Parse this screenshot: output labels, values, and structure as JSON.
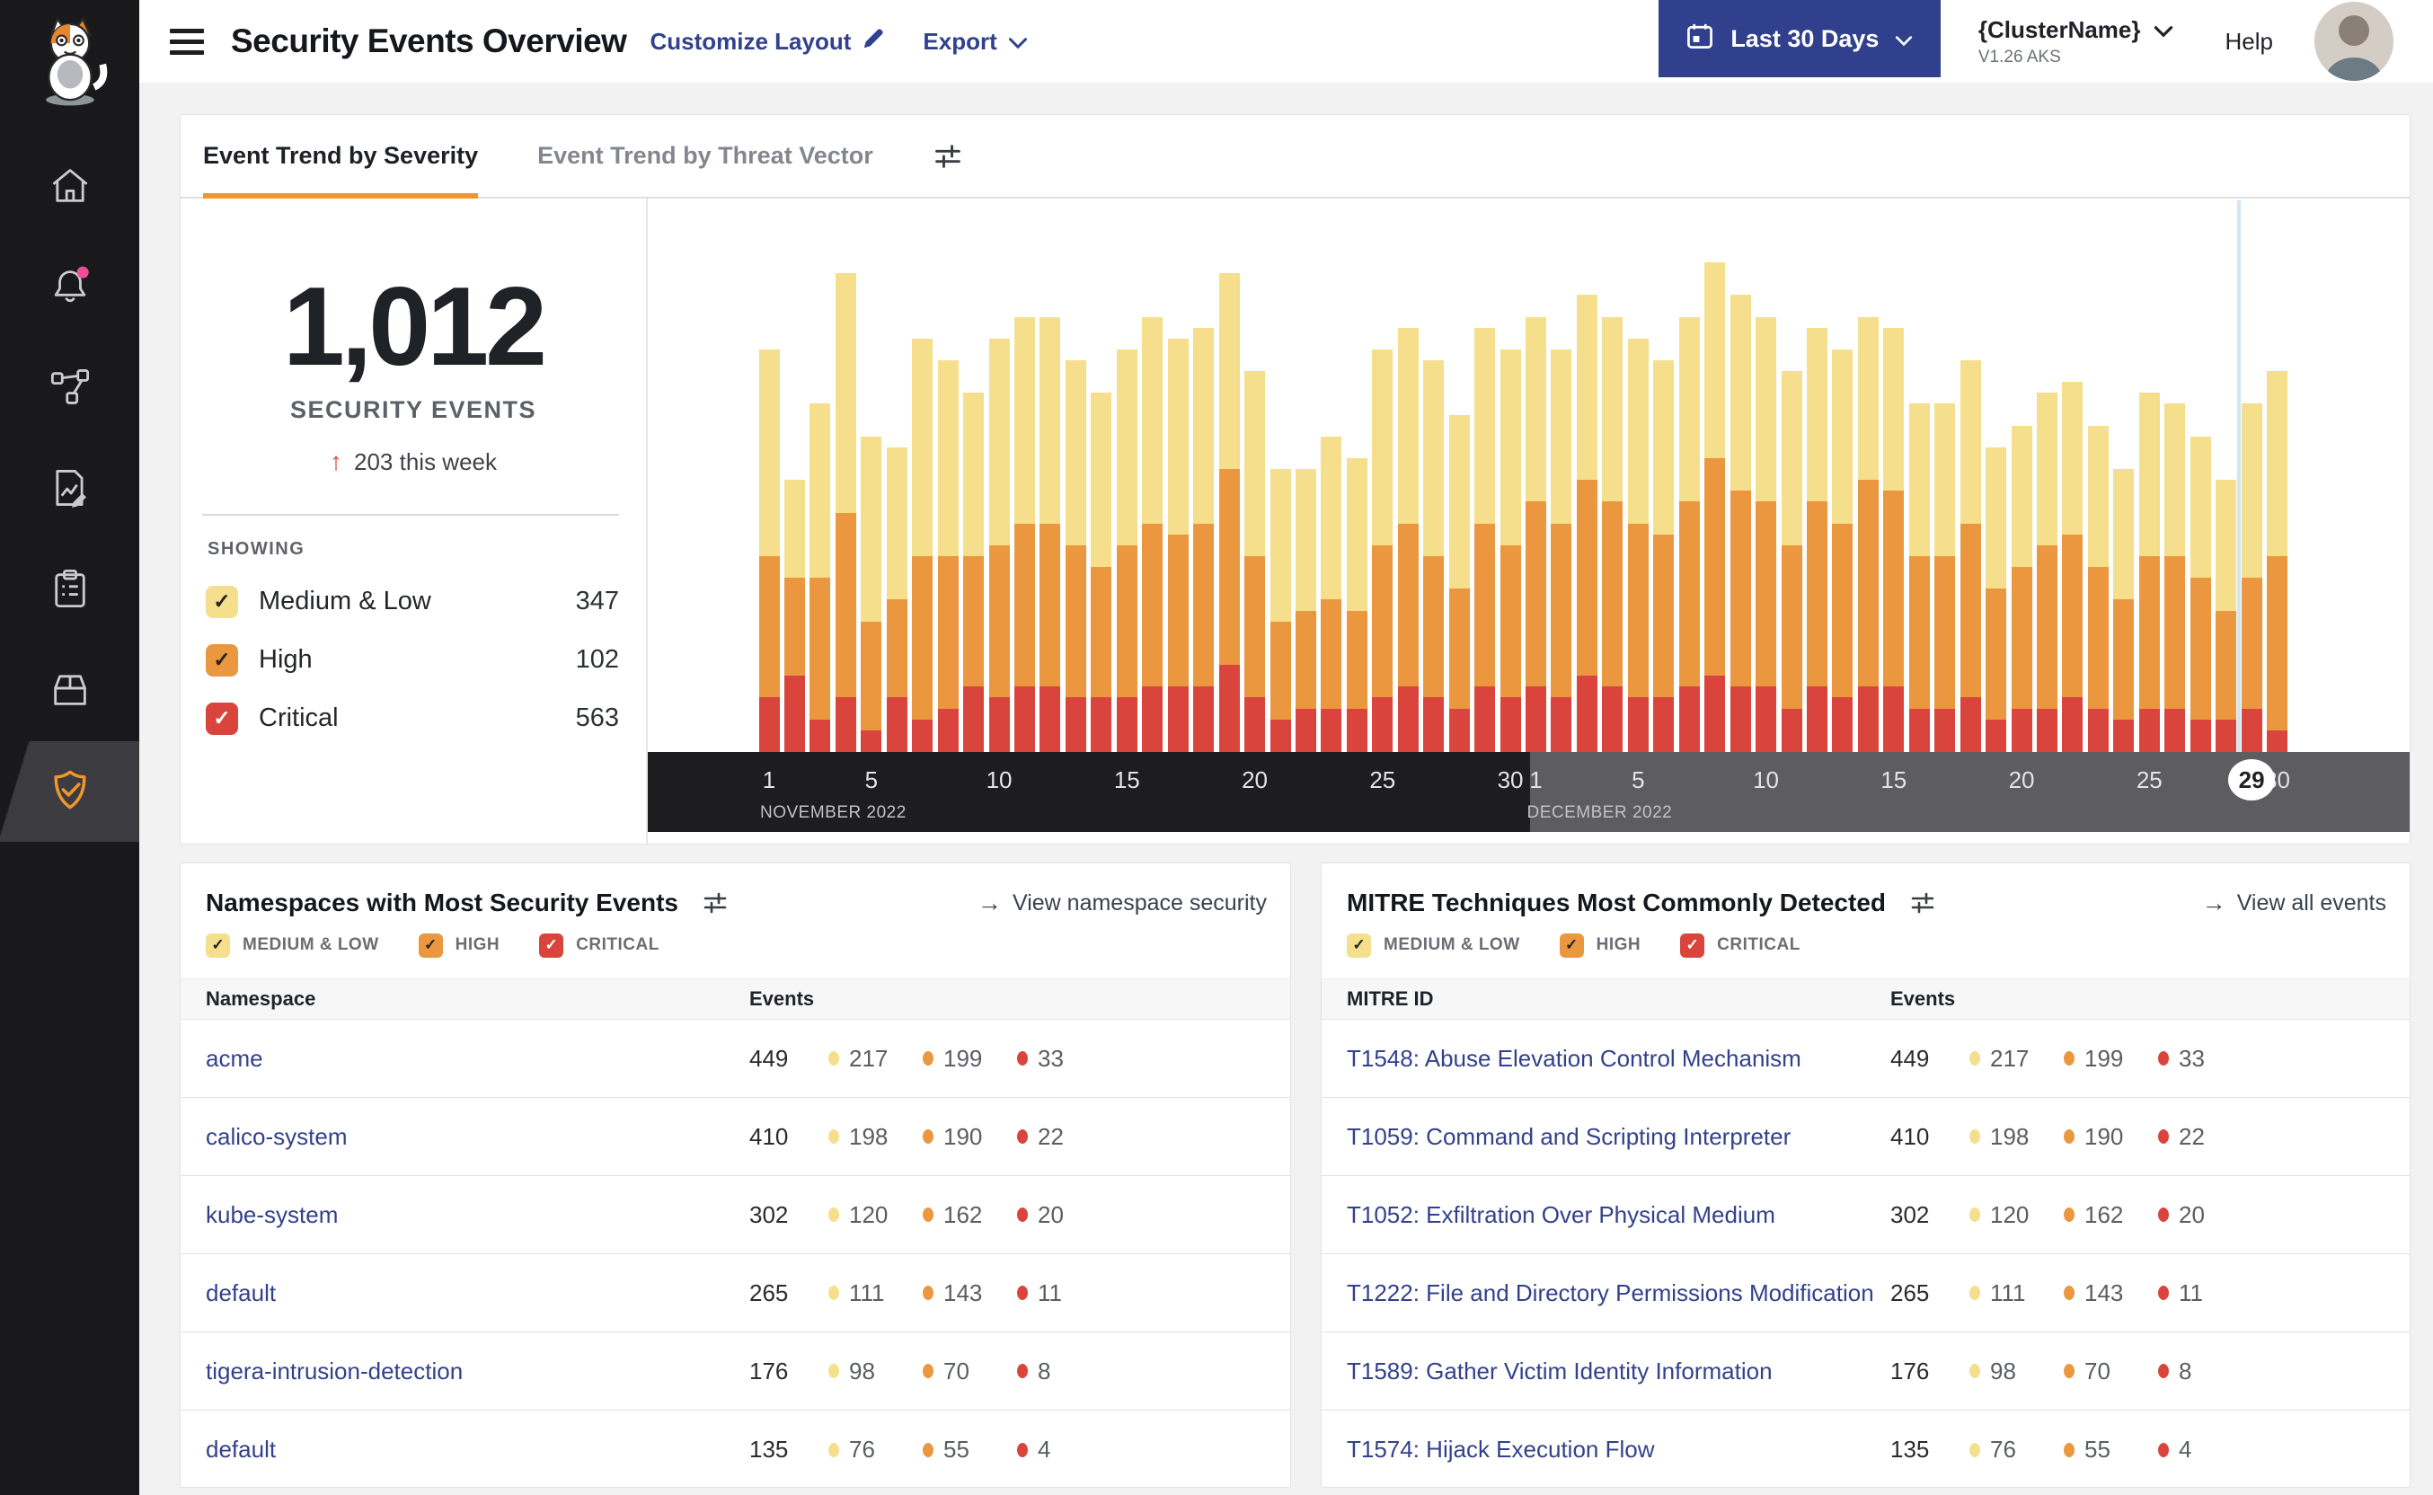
{
  "colors": {
    "medium": "#f5df8c",
    "high": "#eb9740",
    "critical": "#d9453c",
    "accent_orange": "#f0962e",
    "navy": "#30408d",
    "link_blue": "#33418c",
    "notification_pink": "#ef4d98"
  },
  "header": {
    "title": "Security Events Overview",
    "customize_layout": "Customize Layout",
    "export": "Export",
    "date_range": "Last 30 Days",
    "cluster_name": "{ClusterName}",
    "cluster_version": "V1.26 AKS",
    "help": "Help"
  },
  "sidebar": {
    "items": [
      "home",
      "notifications",
      "topology",
      "report",
      "clipboard",
      "package",
      "security"
    ],
    "active_item": "security"
  },
  "trend_card": {
    "tabs": [
      {
        "label": "Event Trend by Severity",
        "active": true
      },
      {
        "label": "Event Trend by Threat Vector",
        "active": false
      }
    ],
    "stats": {
      "total": "1,012",
      "label": "SECURITY EVENTS",
      "delta": "203 this week"
    },
    "showing": {
      "label": "SHOWING",
      "items": [
        {
          "label": "Medium & Low",
          "count": "347",
          "severity": "medium"
        },
        {
          "label": "High",
          "count": "102",
          "severity": "high"
        },
        {
          "label": "Critical",
          "count": "563",
          "severity": "critical"
        }
      ]
    },
    "chart_data": {
      "type": "bar",
      "stacked": true,
      "stack_order": [
        "Critical",
        "High",
        "Medium & Low"
      ],
      "months": [
        {
          "label": "NOVEMBER 2022",
          "days": 30
        },
        {
          "label": "DECEMBER 2022",
          "days": 30
        }
      ],
      "ticks": [
        1,
        5,
        10,
        15,
        20,
        25,
        30
      ],
      "current_day": {
        "month_index": 1,
        "day": 29
      },
      "ylim": [
        0,
        45
      ],
      "series": [
        {
          "name": "Medium & Low",
          "color": "#f5df8c",
          "values": [
            19,
            9,
            16,
            22,
            17,
            14,
            20,
            18,
            15,
            19,
            19,
            19,
            17,
            16,
            18,
            19,
            18,
            18,
            18,
            17,
            14,
            13,
            15,
            14,
            18,
            18,
            18,
            16,
            18,
            18,
            17,
            16,
            17,
            17,
            17,
            16,
            17,
            18,
            18,
            17,
            16,
            16,
            16,
            15,
            15,
            14,
            14,
            15,
            13,
            13,
            14,
            14,
            13,
            12,
            15,
            14,
            13,
            12,
            16,
            17
          ]
        },
        {
          "name": "High",
          "color": "#eb9740",
          "values": [
            13,
            9,
            13,
            17,
            10,
            9,
            15,
            14,
            12,
            14,
            15,
            15,
            14,
            12,
            14,
            15,
            14,
            15,
            18,
            13,
            9,
            9,
            10,
            9,
            14,
            15,
            13,
            11,
            15,
            14,
            17,
            16,
            18,
            17,
            16,
            15,
            17,
            20,
            18,
            17,
            15,
            17,
            16,
            19,
            18,
            14,
            14,
            16,
            12,
            13,
            15,
            15,
            13,
            11,
            14,
            14,
            13,
            10,
            12,
            16
          ]
        },
        {
          "name": "Critical",
          "color": "#d9453c",
          "values": [
            5,
            7,
            3,
            5,
            2,
            5,
            3,
            4,
            6,
            5,
            6,
            6,
            5,
            5,
            5,
            6,
            6,
            6,
            8,
            5,
            3,
            4,
            4,
            4,
            5,
            6,
            5,
            4,
            6,
            5,
            6,
            5,
            7,
            6,
            5,
            5,
            6,
            7,
            6,
            6,
            4,
            6,
            5,
            6,
            6,
            4,
            4,
            5,
            3,
            4,
            4,
            5,
            4,
            3,
            4,
            4,
            3,
            3,
            4,
            2
          ]
        }
      ]
    }
  },
  "namespaces_card": {
    "title": "Namespaces with Most Security Events",
    "link": "View namespace security",
    "filters": [
      "MEDIUM & LOW",
      "HIGH",
      "CRITICAL"
    ],
    "columns": [
      "Namespace",
      "Events"
    ],
    "rows": [
      {
        "name": "acme",
        "total": "449",
        "medium": "217",
        "high": "199",
        "critical": "33"
      },
      {
        "name": "calico-system",
        "total": "410",
        "medium": "198",
        "high": "190",
        "critical": "22"
      },
      {
        "name": "kube-system",
        "total": "302",
        "medium": "120",
        "high": "162",
        "critical": "20"
      },
      {
        "name": "default",
        "total": "265",
        "medium": "111",
        "high": "143",
        "critical": "11"
      },
      {
        "name": "tigera-intrusion-detection",
        "total": "176",
        "medium": "98",
        "high": "70",
        "critical": "8"
      },
      {
        "name": "default",
        "total": "135",
        "medium": "76",
        "high": "55",
        "critical": "4"
      }
    ]
  },
  "mitre_card": {
    "title": "MITRE Techniques Most Commonly Detected",
    "link": "View all events",
    "filters": [
      "MEDIUM & LOW",
      "HIGH",
      "CRITICAL"
    ],
    "columns": [
      "MITRE ID",
      "Events"
    ],
    "rows": [
      {
        "name": "T1548: Abuse Elevation Control Mechanism",
        "total": "449",
        "medium": "217",
        "high": "199",
        "critical": "33"
      },
      {
        "name": "T1059: Command and Scripting Interpreter",
        "total": "410",
        "medium": "198",
        "high": "190",
        "critical": "22"
      },
      {
        "name": "T1052: Exfiltration Over Physical Medium",
        "total": "302",
        "medium": "120",
        "high": "162",
        "critical": "20"
      },
      {
        "name": "T1222: File and Directory Permissions Modification",
        "total": "265",
        "medium": "111",
        "high": "143",
        "critical": "11"
      },
      {
        "name": "T1589: Gather Victim Identity Information",
        "total": "176",
        "medium": "98",
        "high": "70",
        "critical": "8"
      },
      {
        "name": "T1574: Hijack Execution Flow",
        "total": "135",
        "medium": "76",
        "high": "55",
        "critical": "4"
      }
    ]
  }
}
